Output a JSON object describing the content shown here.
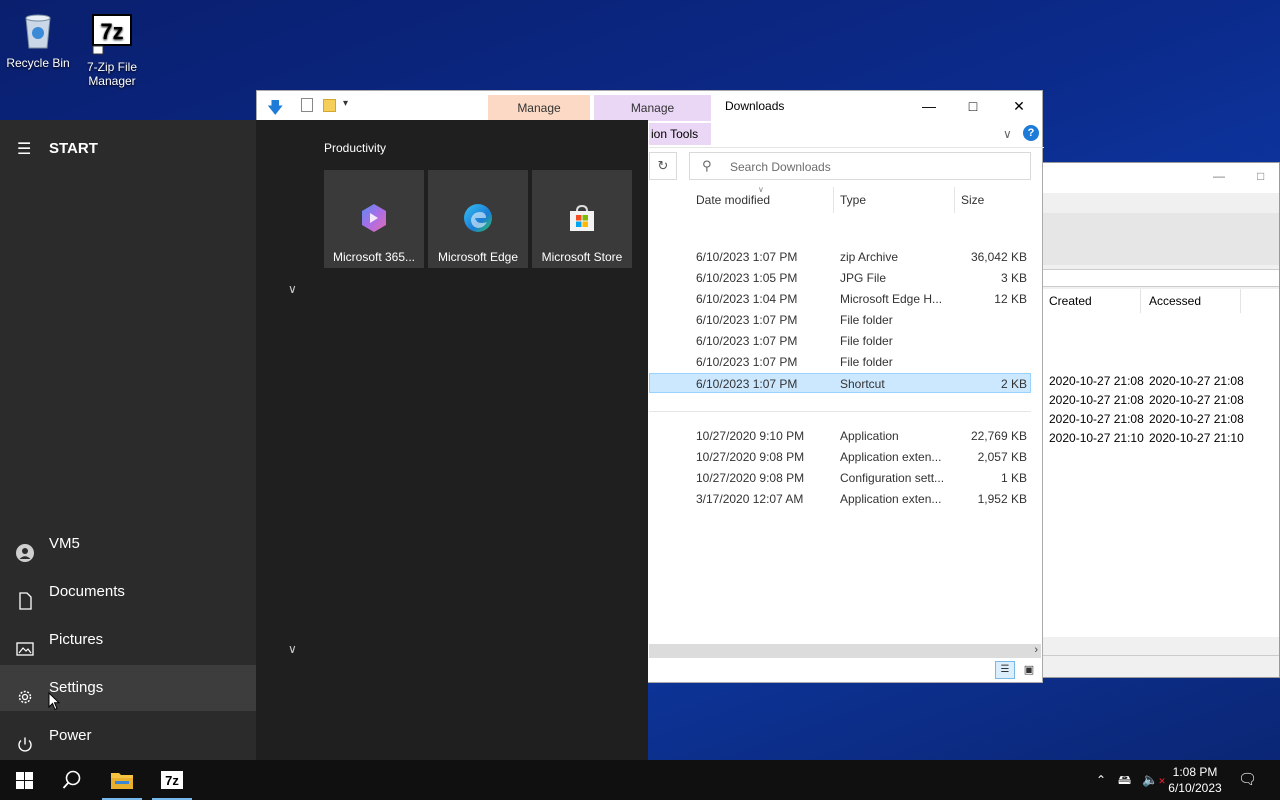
{
  "desktop": {
    "icons": [
      {
        "label": "Recycle Bin"
      },
      {
        "label": "7-Zip File Manager"
      }
    ]
  },
  "explorer": {
    "title": "Downloads",
    "tabs": [
      {
        "label": "Manage",
        "color": "#fbd9c4"
      },
      {
        "label": "Manage",
        "color": "#ead6f5"
      }
    ],
    "ribbon_partial": "ion Tools",
    "search_placeholder": "Search Downloads",
    "columns": {
      "date": "Date modified",
      "type": "Type",
      "size": "Size"
    },
    "files": [
      {
        "date": "6/10/2023 1:07 PM",
        "type": "zip Archive",
        "size": "36,042 KB"
      },
      {
        "date": "6/10/2023 1:05 PM",
        "type": "JPG File",
        "size": "3 KB"
      },
      {
        "date": "6/10/2023 1:04 PM",
        "type": "Microsoft Edge H...",
        "size": "12 KB"
      },
      {
        "date": "6/10/2023 1:07 PM",
        "type": "File folder",
        "size": ""
      },
      {
        "date": "6/10/2023 1:07 PM",
        "type": "File folder",
        "size": ""
      },
      {
        "date": "6/10/2023 1:07 PM",
        "type": "File folder",
        "size": ""
      },
      {
        "date": "6/10/2023 1:07 PM",
        "type": "Shortcut",
        "size": "2 KB"
      }
    ],
    "files2": [
      {
        "date": "10/27/2020 9:10 PM",
        "type": "Application",
        "size": "22,769 KB"
      },
      {
        "date": "10/27/2020 9:08 PM",
        "type": "Application exten...",
        "size": "2,057 KB"
      },
      {
        "date": "10/27/2020 9:08 PM",
        "type": "Configuration sett...",
        "size": "1 KB"
      },
      {
        "date": "3/17/2020 12:07 AM",
        "type": "Application exten...",
        "size": "1,952 KB"
      }
    ]
  },
  "zip": {
    "columns": {
      "created": "Created",
      "accessed": "Accessed"
    },
    "rows": [
      {
        "created": "2020-10-27 21:08",
        "accessed": "2020-10-27 21:08"
      },
      {
        "created": "2020-10-27 21:08",
        "accessed": "2020-10-27 21:08"
      },
      {
        "created": "2020-10-27 21:08",
        "accessed": "2020-10-27 21:08"
      },
      {
        "created": "2020-10-27 21:10",
        "accessed": "2020-10-27 21:10"
      }
    ]
  },
  "start": {
    "header": "START",
    "group_title": "Productivity",
    "tiles": [
      {
        "label": "Microsoft 365..."
      },
      {
        "label": "Microsoft Edge"
      },
      {
        "label": "Microsoft Store"
      }
    ],
    "items": {
      "user": "VM5",
      "documents": "Documents",
      "pictures": "Pictures",
      "settings": "Settings",
      "power": "Power"
    }
  },
  "taskbar": {
    "time": "1:08 PM",
    "date": "6/10/2023"
  },
  "colors": {
    "accent": "#0078d7",
    "selection": "#cce8ff"
  }
}
